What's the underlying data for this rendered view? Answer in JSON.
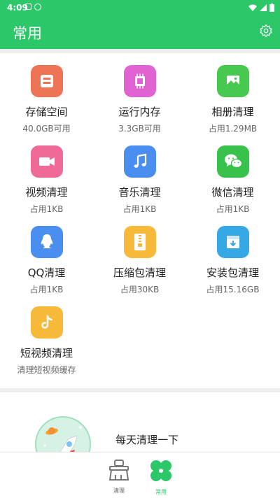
{
  "status": {
    "time": "4:09"
  },
  "appbar": {
    "title": "常用",
    "settings_icon": "gear-icon"
  },
  "colors": {
    "primary": "#2bc768"
  },
  "tiles": [
    {
      "title": "存储空间",
      "subtitle": "40.0GB可用",
      "icon": "storage-icon",
      "color": "#ee7456"
    },
    {
      "title": "运行内存",
      "subtitle": "3.3GB可用",
      "icon": "memory-chip-icon",
      "color": "#e062d3"
    },
    {
      "title": "相册清理",
      "subtitle": "占用1.29MB",
      "icon": "photo-icon",
      "color": "#47c94f"
    },
    {
      "title": "视频清理",
      "subtitle": "占用1KB",
      "icon": "video-icon",
      "color": "#f06a97"
    },
    {
      "title": "音乐清理",
      "subtitle": "占用1KB",
      "icon": "music-icon",
      "color": "#4a8ff0"
    },
    {
      "title": "微信清理",
      "subtitle": "占用1KB",
      "icon": "wechat-icon",
      "color": "#38c24b"
    },
    {
      "title": "QQ清理",
      "subtitle": "占用1KB",
      "icon": "qq-icon",
      "color": "#4a8ff0"
    },
    {
      "title": "压缩包清理",
      "subtitle": "占用30KB",
      "icon": "zip-icon",
      "color": "#f6b93a"
    },
    {
      "title": "安装包清理",
      "subtitle": "占用15.16GB",
      "icon": "install-package-icon",
      "color": "#37a8e6"
    },
    {
      "title": "短视频清理",
      "subtitle": "清理短视频缓存",
      "icon": "tiktok-icon",
      "color": "#f6b93a"
    }
  ],
  "daily": {
    "text": "每天清理一下"
  },
  "bottom_nav": [
    {
      "label": "清理",
      "icon": "broom-icon"
    },
    {
      "label": "常用",
      "icon": "clover-icon"
    }
  ]
}
